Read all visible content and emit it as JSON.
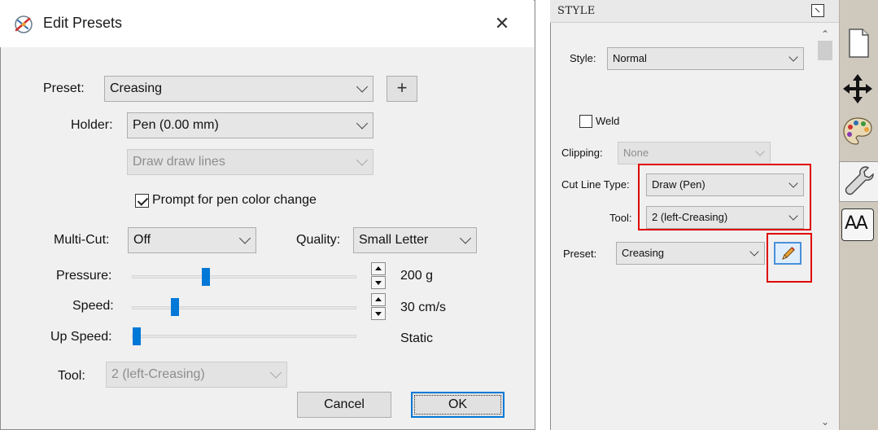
{
  "dialog": {
    "title": "Edit Presets",
    "close_glyph": "✕",
    "preset": {
      "label": "Preset:",
      "value": "Creasing",
      "add_glyph": "+"
    },
    "holder": {
      "label": "Holder:",
      "value": "Pen (0.00 mm)"
    },
    "draw_mode": {
      "value": "Draw draw lines"
    },
    "prompt_pen": {
      "label": "Prompt for pen color change",
      "checked": true
    },
    "multi_cut": {
      "label": "Multi-Cut:",
      "value": "Off"
    },
    "quality": {
      "label": "Quality:",
      "value": "Small Letter"
    },
    "pressure": {
      "label": "Pressure:",
      "value": "200 g"
    },
    "speed": {
      "label": "Speed:",
      "value": "30 cm/s"
    },
    "up_speed": {
      "label": "Up Speed:",
      "value": "Static"
    },
    "tool": {
      "label": "Tool:",
      "value": "2 (left-Creasing)"
    },
    "cancel_label": "Cancel",
    "ok_label": "OK"
  },
  "panel": {
    "title": "STYLE",
    "style": {
      "label": "Style:",
      "value": "Normal"
    },
    "weld": {
      "label": "Weld",
      "checked": false
    },
    "clipping": {
      "label": "Clipping:",
      "value": "None"
    },
    "cut_line_type": {
      "label": "Cut Line Type:",
      "value": "Draw (Pen)"
    },
    "tool": {
      "label": "Tool:",
      "value": "2 (left-Creasing)"
    },
    "preset": {
      "label": "Preset:",
      "value": "Creasing"
    }
  },
  "toolbar": {
    "icons": [
      "page-icon",
      "move-icon",
      "palette-icon",
      "wrench-icon",
      "text-size-icon"
    ],
    "text_icon_label": "AA"
  },
  "colors": {
    "highlight_red": "#e00000",
    "slider_blue": "#0078d7",
    "pencil_orange": "#e8a33a"
  }
}
